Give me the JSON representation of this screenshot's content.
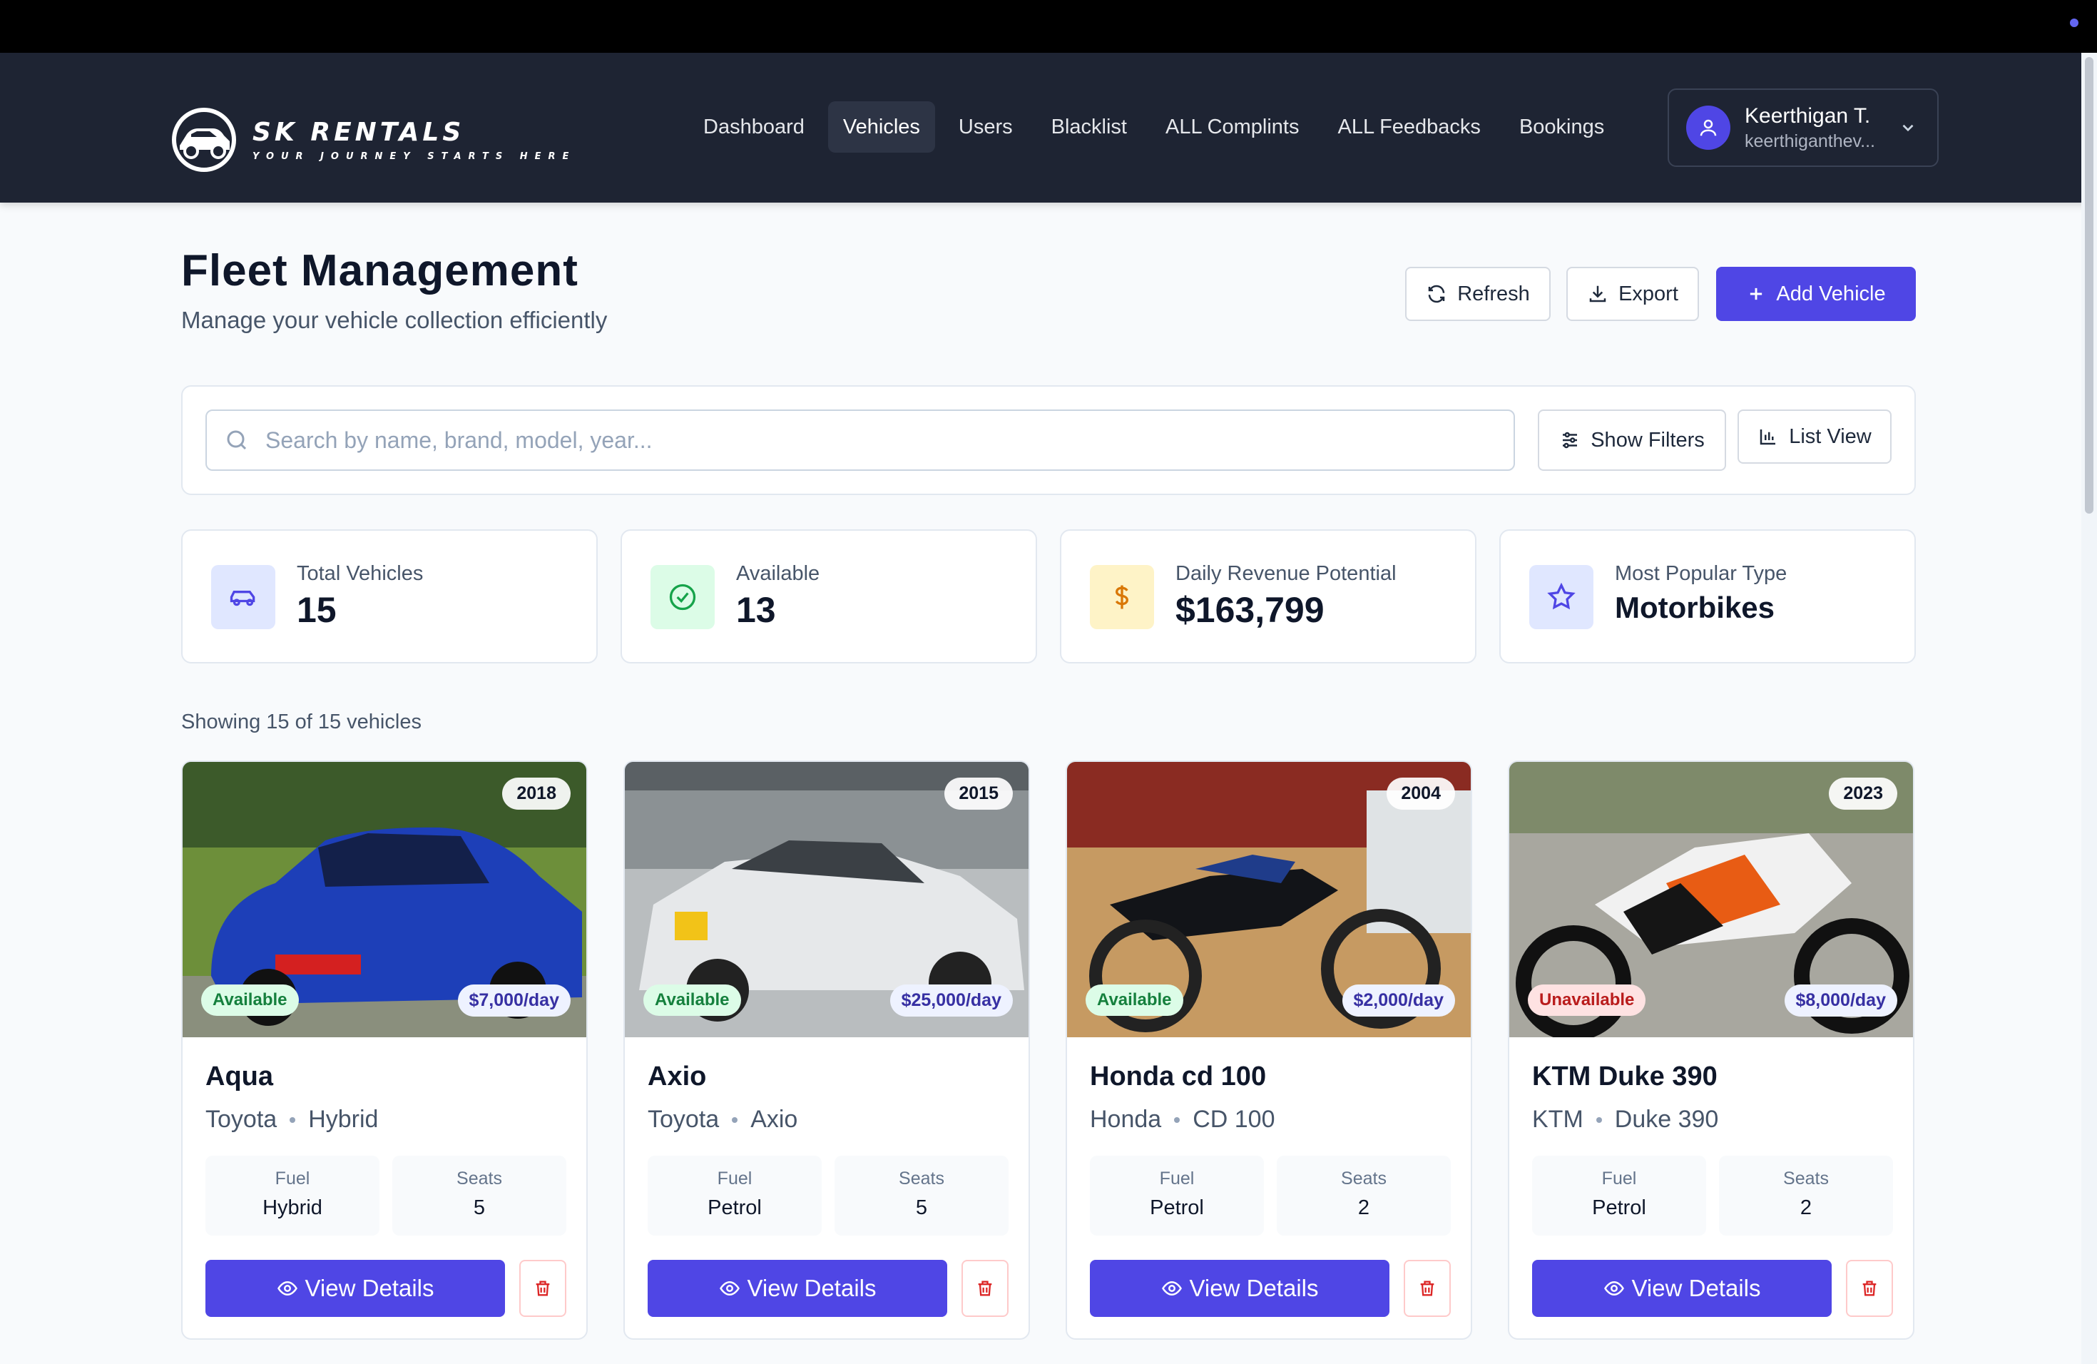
{
  "brand": {
    "name": "SK RENTALS",
    "tagline": "YOUR JOURNEY STARTS HERE"
  },
  "nav": {
    "items": [
      {
        "label": "Dashboard",
        "active": false
      },
      {
        "label": "Vehicles",
        "active": true
      },
      {
        "label": "Users",
        "active": false
      },
      {
        "label": "Blacklist",
        "active": false
      },
      {
        "label": "ALL Complints",
        "active": false
      },
      {
        "label": "ALL Feedbacks",
        "active": false
      },
      {
        "label": "Bookings",
        "active": false
      }
    ]
  },
  "user": {
    "name": "Keerthigan T.",
    "email": "keerthiganthev..."
  },
  "header": {
    "title": "Fleet Management",
    "subtitle": "Manage your vehicle collection efficiently"
  },
  "actions": {
    "refresh": "Refresh",
    "export": "Export",
    "add": "Add Vehicle"
  },
  "search": {
    "placeholder": "Search by name, brand, model, year...",
    "filters_label": "Show Filters",
    "view_label": "List View"
  },
  "stats": [
    {
      "label": "Total Vehicles",
      "value": "15",
      "icon": "car-icon"
    },
    {
      "label": "Available",
      "value": "13",
      "icon": "check-circle-icon"
    },
    {
      "label": "Daily Revenue Potential",
      "value": "$163,799",
      "icon": "dollar-icon"
    },
    {
      "label": "Most Popular Type",
      "value": "Motorbikes",
      "icon": "star-icon"
    }
  ],
  "showing": "Showing 15 of 15 vehicles",
  "vehicles": [
    {
      "name": "Aqua",
      "brand": "Toyota",
      "model": "Hybrid",
      "year": "2018",
      "status": "Available",
      "price": "$7,000/day",
      "fuel_label": "Fuel",
      "fuel": "Hybrid",
      "seats_label": "Seats",
      "seats": "5",
      "view_label": "View Details"
    },
    {
      "name": "Axio",
      "brand": "Toyota",
      "model": "Axio",
      "year": "2015",
      "status": "Available",
      "price": "$25,000/day",
      "fuel_label": "Fuel",
      "fuel": "Petrol",
      "seats_label": "Seats",
      "seats": "5",
      "view_label": "View Details"
    },
    {
      "name": "Honda cd 100",
      "brand": "Honda",
      "model": "CD 100",
      "year": "2004",
      "status": "Available",
      "price": "$2,000/day",
      "fuel_label": "Fuel",
      "fuel": "Petrol",
      "seats_label": "Seats",
      "seats": "2",
      "view_label": "View Details"
    },
    {
      "name": "KTM Duke 390",
      "brand": "KTM",
      "model": "Duke 390",
      "year": "2023",
      "status": "Unavailable",
      "price": "$8,000/day",
      "fuel_label": "Fuel",
      "fuel": "Petrol",
      "seats_label": "Seats",
      "seats": "2",
      "view_label": "View Details"
    }
  ],
  "colors": {
    "primary": "#4f46e5",
    "navbar": "#1e2433",
    "available": "#15803d",
    "unavailable": "#b91c1c"
  }
}
